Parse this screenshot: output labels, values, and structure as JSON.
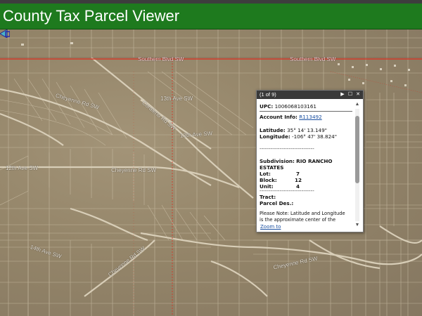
{
  "app": {
    "title": "County Tax Parcel Viewer"
  },
  "map": {
    "streets": [
      {
        "label": "Southern Blvd SW",
        "red": true
      },
      {
        "label": "Southern Blvd SW",
        "red": true
      },
      {
        "label": "Cheyenne Rd SW",
        "red": false
      },
      {
        "label": "13th Ave SW",
        "red": false
      },
      {
        "label": "13th Ave SW",
        "red": false
      },
      {
        "label": "12th Ave SW",
        "red": false
      },
      {
        "label": "Coraleno Rd SW",
        "red": false
      },
      {
        "label": "Cheyenne Rd SW",
        "red": false
      },
      {
        "label": "14th Ave SW",
        "red": false
      },
      {
        "label": "Cheyenne Rd SW",
        "red": false
      },
      {
        "label": "Cheyenne Rd SW",
        "red": false
      }
    ]
  },
  "popup": {
    "count": "(1 of 9)",
    "controls": [
      "▶",
      "☐",
      "✕"
    ],
    "upc_label": "UPC:",
    "upc_value": "1006068103161",
    "account_label": "Account Info:",
    "account_link": "R113492",
    "latitude_label": "Latitude:",
    "latitude_value": "35° 14' 13.149\"",
    "longitude_label": "Longitude:",
    "longitude_value": "-106° 47' 38.824\"",
    "dash_line": "------------------------------",
    "subdivision_label": "Subdivision:",
    "subdivision_value": "RIO RANCHO",
    "subdivision_value2": "ESTATES",
    "lot_label": "Lot:",
    "lot_value": "7",
    "block_label": "Block:",
    "block_value": "12",
    "unit_label": "Unit:",
    "unit_value": "4",
    "tract_label": "Tract:",
    "parcel_des_label": "Parcel Des.:",
    "note_line1": "Please Note: Latitude and Longitude",
    "note_line2": "is the approximate center of the",
    "zoom_link": "Zoom to"
  },
  "colors": {
    "titlebar": "#1e7a1e",
    "popup_header": "#393939",
    "link": "#1a4fa0",
    "road_red": "#d23a2a"
  }
}
